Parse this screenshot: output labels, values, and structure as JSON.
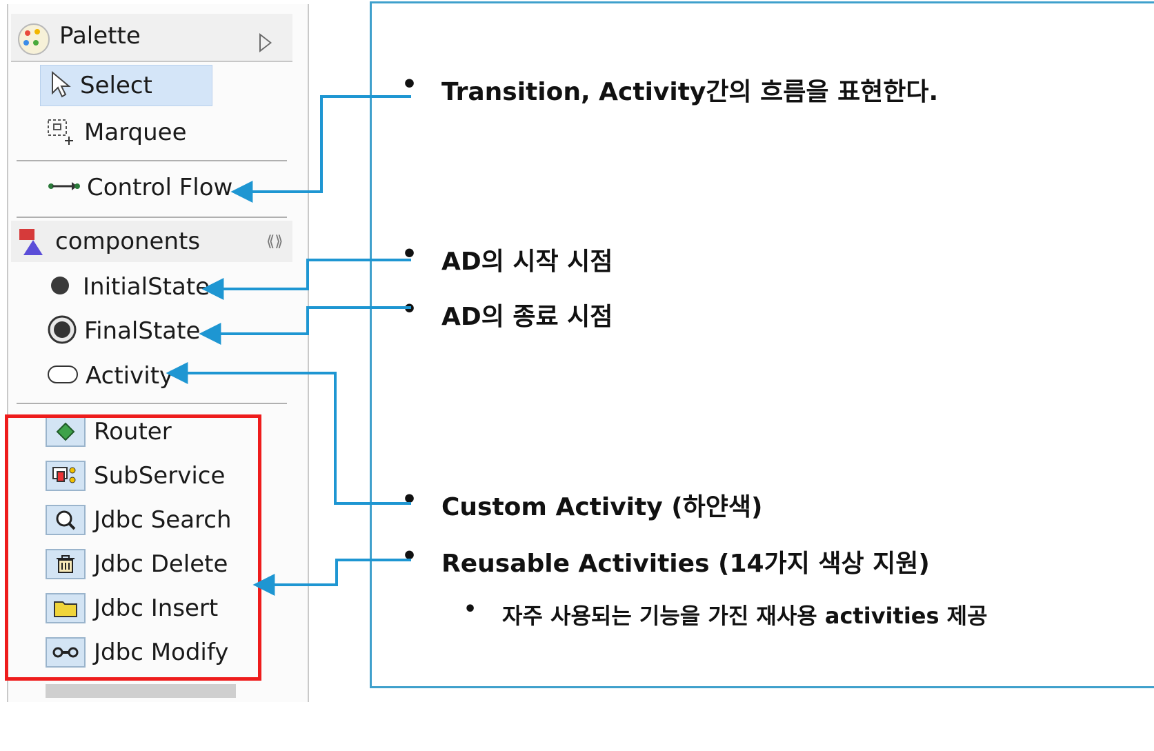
{
  "palette": {
    "title": "Palette",
    "tools": [
      {
        "label": "Select",
        "icon": "pointer-icon"
      },
      {
        "label": "Marquee",
        "icon": "marquee-icon"
      },
      {
        "label": "Control Flow",
        "icon": "control-flow-icon"
      }
    ],
    "drawer": {
      "label": "components",
      "icon": "components-icon"
    },
    "components": [
      {
        "label": "InitialState",
        "icon": "initial-state-icon"
      },
      {
        "label": "FinalState",
        "icon": "final-state-icon"
      },
      {
        "label": "Activity",
        "icon": "activity-icon"
      }
    ],
    "reusable": [
      {
        "label": "Router",
        "icon": "router-icon"
      },
      {
        "label": "SubService",
        "icon": "subservice-icon"
      },
      {
        "label": "Jdbc Search",
        "icon": "search-icon"
      },
      {
        "label": "Jdbc Delete",
        "icon": "delete-icon"
      },
      {
        "label": "Jdbc Insert",
        "icon": "folder-icon"
      },
      {
        "label": "Jdbc Modify",
        "icon": "modify-icon"
      }
    ]
  },
  "notes": {
    "transition": "Transition,  Activity간의 흐름을 표현한다.",
    "initial": "AD의 시작 시점",
    "final": "AD의 종료 시점",
    "custom": "Custom Activity (하얀색)",
    "reusable": "Reusable Activities (14가지 색상 지원)",
    "reusable_sub": "자주 사용되는 기능을 가진 재사용 activities 제공"
  },
  "colors": {
    "connector": "#1e96d2",
    "highlight": "#ee1c1c",
    "panel_border": "#3fa0cc"
  }
}
